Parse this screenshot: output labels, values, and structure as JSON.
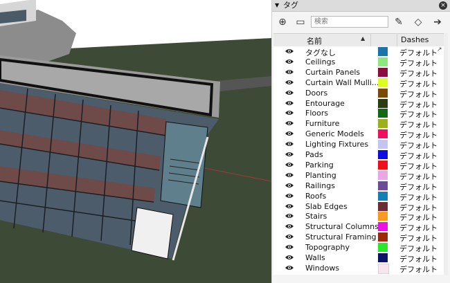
{
  "panel": {
    "title": "タグ",
    "close": "×",
    "collapse_arrow": "▼",
    "search_placeholder": "検索",
    "toolbar": {
      "add_tag": "⊕",
      "add_folder": "▭",
      "color_by_tag": "◇",
      "tag_tool": "✎",
      "details": "➔"
    },
    "columns": {
      "name": "名前",
      "sort": "▲",
      "dashes": "Dashes"
    },
    "pointer_glyph": "↗",
    "rows": [
      {
        "name": "タグなし",
        "color": "#1a74a6",
        "dashes": "デフォルト"
      },
      {
        "name": "Ceilings",
        "color": "#8ce87c",
        "dashes": "デフォルト"
      },
      {
        "name": "Curtain Panels",
        "color": "#8b0c3e",
        "dashes": "デフォルト"
      },
      {
        "name": "Curtain Wall Mulli...",
        "color": "#dcff1f",
        "dashes": "デフォルト"
      },
      {
        "name": "Doors",
        "color": "#7a4a08",
        "dashes": "デフォルト"
      },
      {
        "name": "Entourage",
        "color": "#2a3d11",
        "dashes": "デフォルト"
      },
      {
        "name": "Floors",
        "color": "#146814",
        "dashes": "デフォルト"
      },
      {
        "name": "Furniture",
        "color": "#9ab11c",
        "dashes": "デフォルト"
      },
      {
        "name": "Generic Models",
        "color": "#ee1160",
        "dashes": "デフォルト"
      },
      {
        "name": "Lighting Fixtures",
        "color": "#c4c6f0",
        "dashes": "デフォルト"
      },
      {
        "name": "Pads",
        "color": "#0d0de0",
        "dashes": "デフォルト"
      },
      {
        "name": "Parking",
        "color": "#ee0f1a",
        "dashes": "デフォルト"
      },
      {
        "name": "Planting",
        "color": "#eba6e6",
        "dashes": "デフォルト"
      },
      {
        "name": "Railings",
        "color": "#6e4c94",
        "dashes": "デフォルト"
      },
      {
        "name": "Roofs",
        "color": "#1280b4",
        "dashes": "デフォルト"
      },
      {
        "name": "Slab Edges",
        "color": "#6b2e34",
        "dashes": "デフォルト"
      },
      {
        "name": "Stairs",
        "color": "#f79a22",
        "dashes": "デフォルト"
      },
      {
        "name": "Structural Columns",
        "color": "#ec12e4",
        "dashes": "デフォルト"
      },
      {
        "name": "Structural Framing",
        "color": "#9c2a08",
        "dashes": "デフォルト"
      },
      {
        "name": "Topography",
        "color": "#28e828",
        "dashes": "デフォルト"
      },
      {
        "name": "Walls",
        "color": "#0d1466",
        "dashes": "デフォルト"
      },
      {
        "name": "Windows",
        "color": "#f8e6ee",
        "dashes": "デフォルト"
      }
    ]
  }
}
